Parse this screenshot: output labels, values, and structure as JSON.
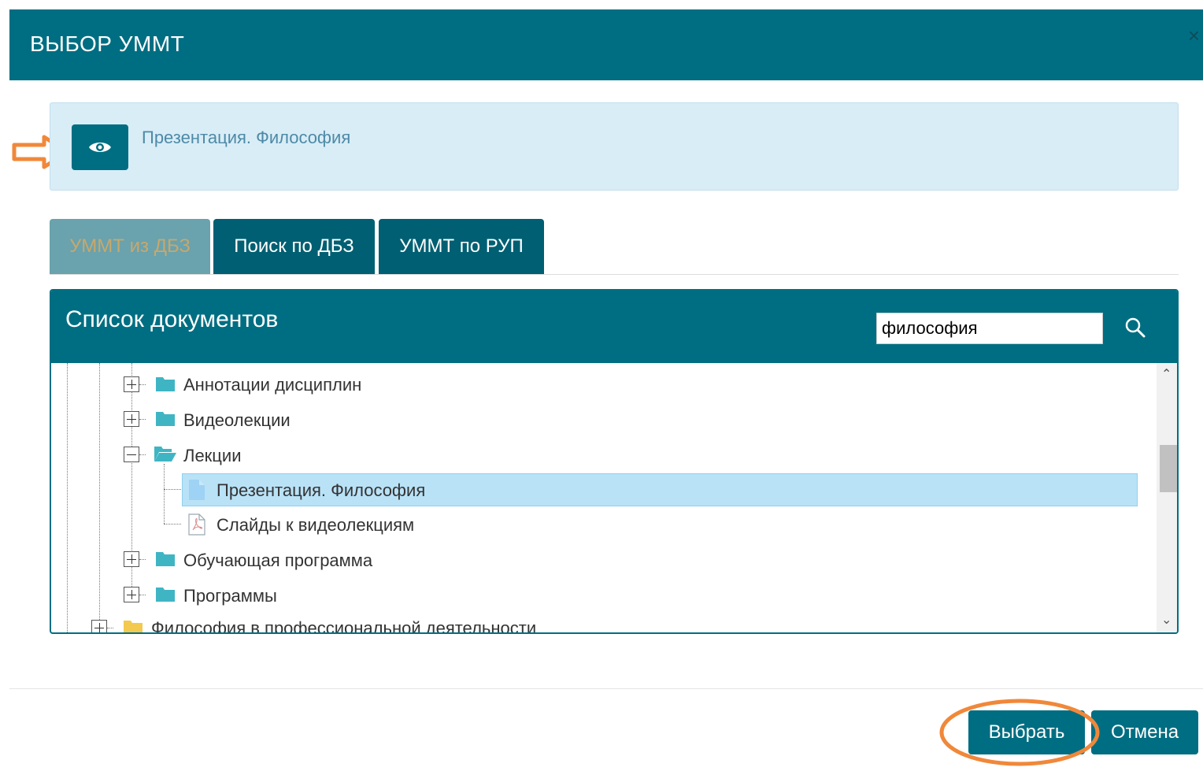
{
  "dialog": {
    "title": "ВЫБОР УММТ",
    "close_label": "×"
  },
  "preview": {
    "document_name": "Презентация. Философия"
  },
  "tabs": [
    {
      "label": "УММТ из ДБЗ",
      "state": "disabled"
    },
    {
      "label": "Поиск по ДБЗ",
      "state": "normal"
    },
    {
      "label": "УММТ по РУП",
      "state": "normal"
    }
  ],
  "document_list": {
    "title": "Список документов",
    "search_value": "философия",
    "tree": [
      {
        "label": "Аннотации дисциплин",
        "type": "folder",
        "expanded": false
      },
      {
        "label": "Видеолекции",
        "type": "folder",
        "expanded": false
      },
      {
        "label": "Лекции",
        "type": "folder",
        "expanded": true
      },
      {
        "label": "Презентация. Философия",
        "type": "document",
        "selected": true
      },
      {
        "label": "Слайды к видеолекциям",
        "type": "pdf"
      },
      {
        "label": "Обучающая программа",
        "type": "folder",
        "expanded": false
      },
      {
        "label": "Программы",
        "type": "folder",
        "expanded": false
      },
      {
        "label": "Философия в профессиональной деятельности",
        "type": "folder",
        "expanded": false
      }
    ]
  },
  "footer": {
    "select_label": "Выбрать",
    "cancel_label": "Отмена"
  },
  "colors": {
    "primary": "#006e82",
    "selected_row": "#b9e2f7",
    "folder": "#3fb5c4",
    "annotation": "#f0883a"
  }
}
